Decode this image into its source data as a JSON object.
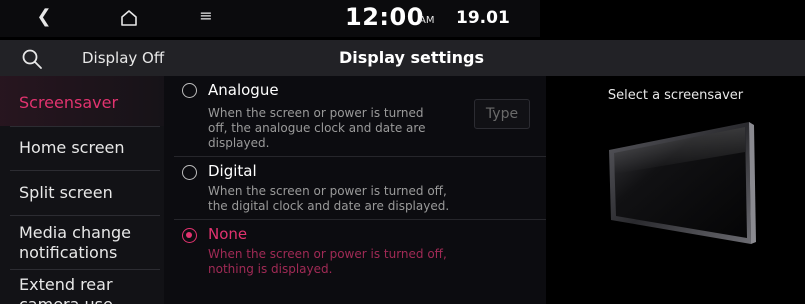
{
  "status_bar": {
    "back_icon": "chevron-left-icon",
    "home_icon": "home-icon",
    "menu_icon": "menu-icon",
    "time": "12:00",
    "ampm": "AM",
    "date": "19.01"
  },
  "header": {
    "search_icon": "search-icon",
    "display_off_label": "Display Off",
    "title": "Display settings"
  },
  "sidebar": {
    "items": [
      {
        "label": "Screensaver",
        "active": true
      },
      {
        "label": "Home screen",
        "active": false
      },
      {
        "label": "Split screen",
        "active": false
      },
      {
        "label": "Media change notifications",
        "active": false
      },
      {
        "label": "Extend rear camera use",
        "active": false
      }
    ],
    "item_lines": {
      "media_line1": "Media change",
      "media_line2": "notifications",
      "extend_line1": "Extend rear",
      "extend_line2": "camera use"
    }
  },
  "options": [
    {
      "label": "Analogue",
      "selected": false,
      "desc_lines": [
        "When the screen or power is turned",
        "off, the analogue clock and date are",
        "displayed."
      ],
      "type_button": "Type"
    },
    {
      "label": "Digital",
      "selected": false,
      "desc_lines": [
        "When the screen or power is turned off,",
        "the digital clock and date are displayed."
      ]
    },
    {
      "label": "None",
      "selected": true,
      "desc_lines": [
        "When the screen or power is turned off,",
        "nothing is displayed."
      ]
    }
  ],
  "preview": {
    "label": "Select a screensaver"
  },
  "colors": {
    "accent": "#e2336f",
    "background": "#000000",
    "header_bg": "#222226",
    "sidebar_bg": "#121216"
  }
}
